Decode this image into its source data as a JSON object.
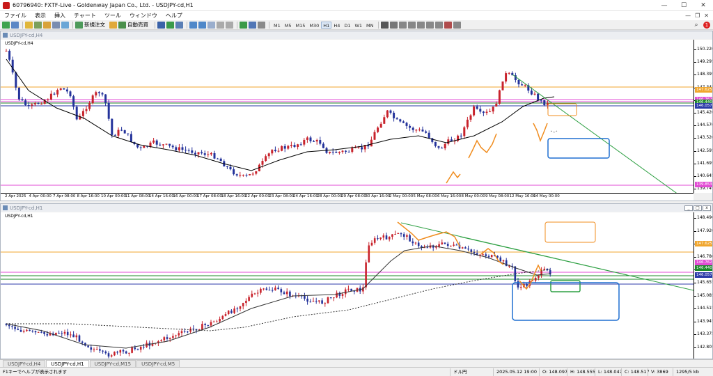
{
  "window": {
    "title": "60796940: FXTF-Live - Goldenway Japan Co., Ltd. - USDJPY-cd,H1",
    "minimize": "—",
    "maximize": "☐",
    "close": "✕"
  },
  "menu": [
    "ファイル",
    "表示",
    "挿入",
    "チャート",
    "ツール",
    "ウィンドウ",
    "ヘルプ"
  ],
  "toolbar": {
    "new_order": "新規注文",
    "auto_trade": "自動売買",
    "timeframes": [
      "M1",
      "M5",
      "M15",
      "M30",
      "H1",
      "H4",
      "D1",
      "W1",
      "MN"
    ],
    "active_timeframe": "H1",
    "info_badge": "1"
  },
  "chart_h4": {
    "window_title": "USDJPY-cd,H4",
    "symbol_label": "USDJPY-cd,H4",
    "y_ticks": [
      "150.220",
      "149.295",
      "148.395",
      "147.345",
      "146.445",
      "145.420",
      "144.570",
      "143.520",
      "142.595",
      "141.695",
      "140.645",
      "139.745"
    ],
    "price_tags": [
      {
        "text": "147.625",
        "color": "#f0a62e"
      },
      {
        "text": "146.762",
        "color": "#e24bd4"
      },
      {
        "text": "146.440",
        "color": "#1c8a2a"
      },
      {
        "text": "146.057",
        "color": "#2b3aa8"
      },
      {
        "text": "139.853",
        "color": "#e24bd4"
      }
    ],
    "x_labels": [
      "2 Apr 2025",
      "4 Apr 00:00",
      "7 Apr 08:00",
      "8 Apr 16:00",
      "10 Apr 00:00",
      "11 Apr 08:00",
      "14 Apr 16:00",
      "16 Apr 00:00",
      "17 Apr 08:00",
      "18 Apr 16:00",
      "22 Apr 00:00",
      "23 Apr 08:00",
      "24 Apr 16:00",
      "28 Apr 00:00",
      "29 Apr 08:00",
      "30 Apr 16:00",
      "2 May 00:00",
      "5 May 08:00",
      "6 May 16:00",
      "8 May 00:00",
      "9 May 08:00",
      "12 May 16:00",
      "14 May 00:00"
    ],
    "colors": {
      "bull": "#c8232c",
      "bear": "#24339b",
      "ma": "#000000",
      "resistance": "#f0a62e",
      "pink": "#e24bd4",
      "green": "#1c8a2a",
      "blue": "#2b3aa8",
      "trend": "#2ea043",
      "orange": "#f08c1e",
      "box_blue": "#1e6fd0"
    }
  },
  "chart_h1": {
    "window_title": "USDJPY-cd,H1",
    "symbol_label": "USDJPY-cd,H1",
    "y_ticks": [
      "148.490",
      "147.920",
      "147.350",
      "146.780",
      "146.225",
      "145.655",
      "145.085",
      "144.515",
      "143.945",
      "143.375",
      "142.805"
    ],
    "price_tags": [
      {
        "text": "147.625",
        "color": "#f0a62e"
      },
      {
        "text": "146.762",
        "color": "#e24bd4"
      },
      {
        "text": "146.440",
        "color": "#1c8a2a"
      },
      {
        "text": "146.057",
        "color": "#2b3aa8"
      }
    ]
  },
  "tabs": [
    "USDJPY-cd,H4",
    "USDJPY-cd,H1",
    "USDJPY-cd,M15",
    "USDJPY-cd,M5"
  ],
  "active_tab": "USDJPY-cd,H1",
  "status": {
    "help": "F1キーでヘルプが表示されます",
    "profile": "ドル円",
    "datetime": "2025.05.12 19:00",
    "open": "O: 148.097",
    "high": "H: 148.555",
    "low": "L: 148.047",
    "close": "C: 148.517",
    "volume": "V: 3869",
    "traffic": "1295/5 kb"
  }
}
